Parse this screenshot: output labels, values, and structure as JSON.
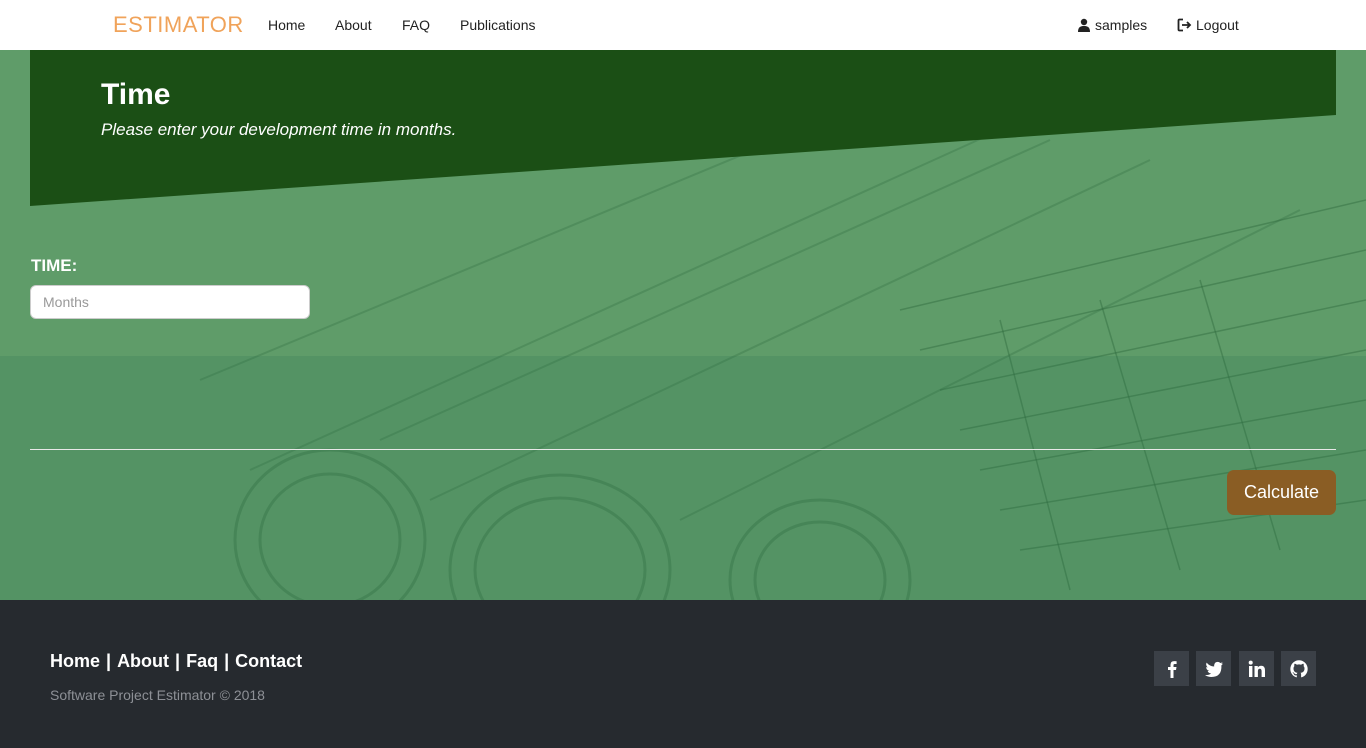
{
  "navbar": {
    "logo": "ESTIMATOR",
    "links": [
      "Home",
      "About",
      "FAQ",
      "Publications"
    ],
    "user_label": "samples",
    "logout_label": "Logout"
  },
  "hero": {
    "title": "Time",
    "subtitle": "Please enter your development time in months."
  },
  "form": {
    "time_label": "TIME:",
    "time_placeholder": "Months",
    "time_value": "",
    "calculate_label": "Calculate"
  },
  "footer": {
    "links": [
      "Home",
      "About",
      "Faq",
      "Contact"
    ],
    "separator": "|",
    "copyright": "Software Project Estimator © 2018",
    "social_icons": [
      "facebook-icon",
      "twitter-icon",
      "linkedin-icon",
      "github-icon"
    ]
  },
  "colors": {
    "brand": "#f0a35a",
    "hero_panel": "#1b4f15",
    "background": "#5f9c69",
    "button": "#8a5d24",
    "footer": "#262a2f"
  }
}
